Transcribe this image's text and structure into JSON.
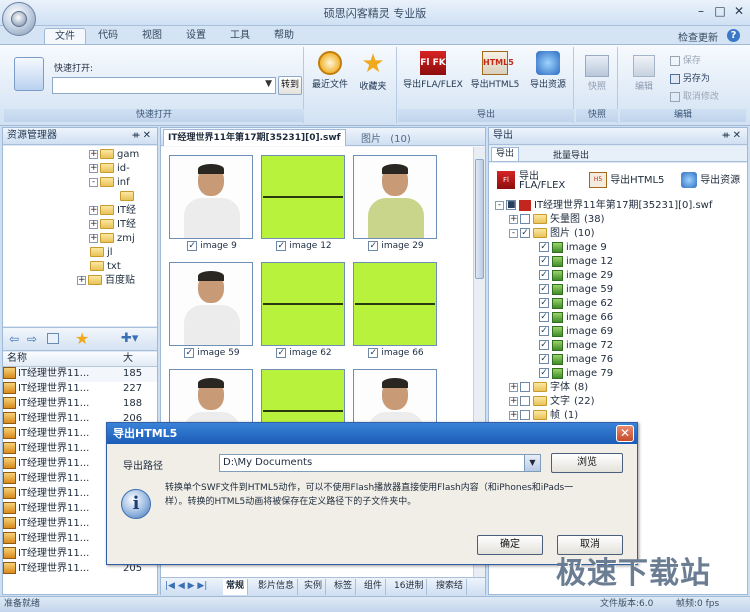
{
  "window": {
    "title": "硕思闪客精灵 专业版",
    "controls": [
      "minimize",
      "maximize",
      "close"
    ]
  },
  "tabs": [
    "文件",
    "代码",
    "视图",
    "设置",
    "工具",
    "帮助"
  ],
  "active_tab": "文件",
  "check_update": "检查更新",
  "ribbon": {
    "quick_open_label": "快速打开:",
    "quick_open_value": "",
    "goto_button": "转到",
    "recent_files": "最近文件",
    "favorites": "收藏夹",
    "group_quick_open": "快速打开",
    "export_fla": "导出FLA/FLEX",
    "export_html5": "导出HTML5",
    "export_resources": "导出资源",
    "group_export": "导出",
    "snapshot": "快照",
    "group_snapshot": "快照",
    "edit": "编辑",
    "save": "保存",
    "save_as": "另存为",
    "cancel_edit": "取消修改",
    "group_edit": "编辑"
  },
  "explorer": {
    "title": "资源管理器",
    "tree": [
      {
        "expand": "+",
        "label": "gam"
      },
      {
        "expand": "+",
        "label": "id-"
      },
      {
        "expand": "-",
        "label": "inf"
      },
      {
        "expand": "",
        "label": ""
      },
      {
        "expand": "+",
        "label": "IT经"
      },
      {
        "expand": "+",
        "label": "IT经"
      },
      {
        "expand": "+",
        "label": "zmj"
      },
      {
        "expand": "",
        "label": "jl"
      },
      {
        "expand": "",
        "label": "txt"
      },
      {
        "expand": "+",
        "label": "百度贴"
      }
    ],
    "list_header_name": "名称",
    "list_header_size": "大",
    "files": [
      {
        "name": "IT经理世界11...",
        "size": "185"
      },
      {
        "name": "IT经理世界11...",
        "size": "227"
      },
      {
        "name": "IT经理世界11...",
        "size": "188"
      },
      {
        "name": "IT经理世界11...",
        "size": "206"
      },
      {
        "name": "IT经理世界11...",
        "size": ""
      },
      {
        "name": "IT经理世界11...",
        "size": ""
      },
      {
        "name": "IT经理世界11...",
        "size": ""
      },
      {
        "name": "IT经理世界11...",
        "size": ""
      },
      {
        "name": "IT经理世界11...",
        "size": ""
      },
      {
        "name": "IT经理世界11...",
        "size": ""
      },
      {
        "name": "IT经理世界11...",
        "size": ""
      },
      {
        "name": "IT经理世界11...",
        "size": ""
      },
      {
        "name": "IT经理世界11...",
        "size": ""
      },
      {
        "name": "IT经理世界11...",
        "size": "205"
      }
    ]
  },
  "viewer": {
    "file_tab": "IT经理世界11年第17期[35231][0].swf",
    "images_tab": "图片",
    "images_count": "(10)",
    "thumbs": [
      {
        "label": "image 9",
        "kind": "photo"
      },
      {
        "label": "image 12",
        "kind": "green"
      },
      {
        "label": "image 29",
        "kind": "photo"
      },
      {
        "label": "image 59",
        "kind": "photo"
      },
      {
        "label": "image 62",
        "kind": "green"
      },
      {
        "label": "image 66",
        "kind": "green"
      },
      {
        "label": "",
        "kind": "photo"
      },
      {
        "label": "",
        "kind": "green"
      },
      {
        "label": "",
        "kind": "photo"
      }
    ],
    "bottom_tabs": [
      "常规",
      "影片信息",
      "实例",
      "标签",
      "组件",
      "16进制",
      "搜索结"
    ]
  },
  "export_panel": {
    "title": "导出",
    "tab_export": "导出",
    "tab_batch": "批量导出",
    "btn_fla": "导出\nFLA/FLEX",
    "btn_fla_line1": "导出",
    "btn_fla_line2": "FLA/FLEX",
    "btn_html5": "导出HTML5",
    "btn_res": "导出资源",
    "tree_root": "IT经理世界11年第17期[35231][0].swf",
    "nodes": [
      {
        "label": "矢量图",
        "count": "(38)",
        "expand": "+",
        "checked": false
      },
      {
        "label": "图片",
        "count": "(10)",
        "expand": "-",
        "checked": true
      }
    ],
    "images": [
      "image 9",
      "image 12",
      "image 29",
      "image 59",
      "image 62",
      "image 66",
      "image 69",
      "image 72",
      "image 76",
      "image 79"
    ],
    "after_nodes": [
      {
        "label": "字体",
        "count": "(8)"
      },
      {
        "label": "文字",
        "count": "(22)"
      },
      {
        "label": "帧",
        "count": "(1)"
      }
    ]
  },
  "dialog": {
    "title": "导出HTML5",
    "path_label": "导出路径",
    "path_value": "D:\\My Documents",
    "browse": "浏览",
    "info_line1": "转换单个SWF文件到HTML5动作，可以不使用Flash播放器直接使用Flash内容（和iPhones和iPads一",
    "info_line2": "样）。转换的HTML5动画将被保存在定义路径下的子文件夹中。",
    "ok": "确定",
    "cancel": "取消"
  },
  "status": {
    "left": "准备就绪",
    "version": "文件版本:6.0",
    "fps": "帧频:0 fps"
  },
  "watermark": "极速下载站"
}
